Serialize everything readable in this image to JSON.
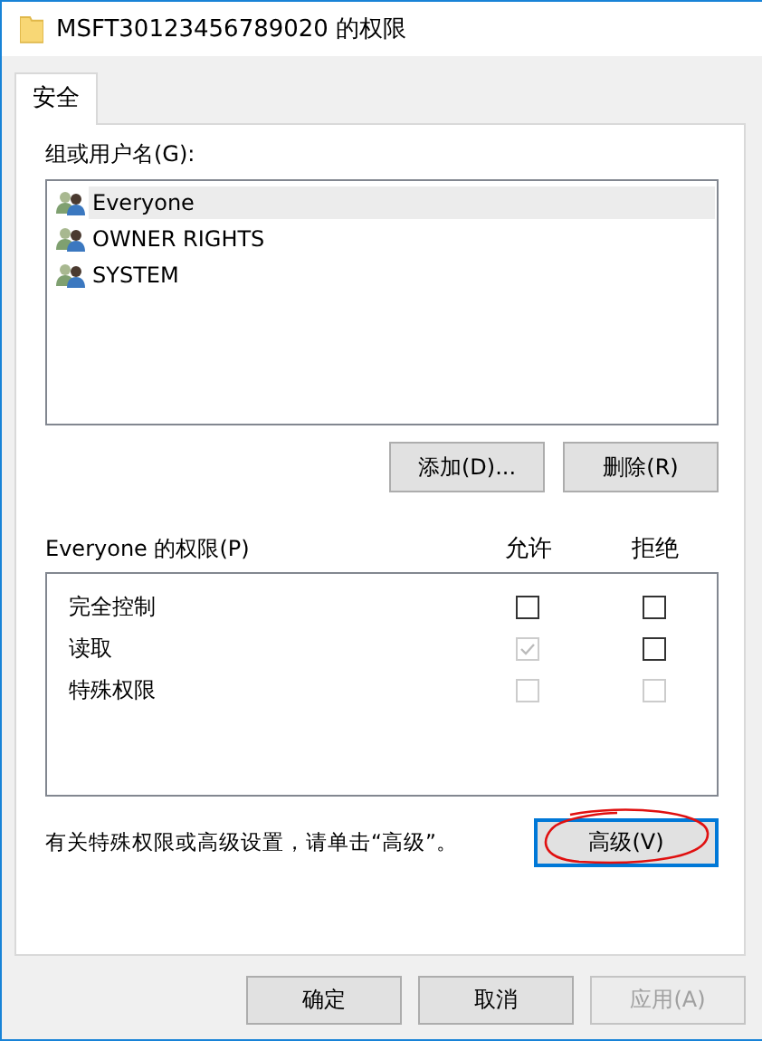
{
  "window": {
    "title": "MSFT30123456789020 的权限"
  },
  "tabs": [
    {
      "label": "安全",
      "selected": true
    }
  ],
  "groups": {
    "label": "组或用户名(G):",
    "items": [
      {
        "name": "Everyone",
        "selected": true
      },
      {
        "name": "OWNER RIGHTS",
        "selected": false
      },
      {
        "name": "SYSTEM",
        "selected": false
      }
    ]
  },
  "group_buttons": [
    {
      "label": "添加(D)..."
    },
    {
      "label": "删除(R)"
    }
  ],
  "permissions": {
    "label": "Everyone 的权限(P)",
    "allow_header": "允许",
    "deny_header": "拒绝",
    "rows": [
      {
        "name": "完全控制",
        "allow": {
          "checked": false,
          "disabled": false
        },
        "deny": {
          "checked": false,
          "disabled": false
        }
      },
      {
        "name": "读取",
        "allow": {
          "checked": true,
          "disabled": true
        },
        "deny": {
          "checked": false,
          "disabled": false
        }
      },
      {
        "name": "特殊权限",
        "allow": {
          "checked": false,
          "disabled": true
        },
        "deny": {
          "checked": false,
          "disabled": true
        }
      }
    ]
  },
  "advanced_note": "有关特殊权限或高级设置，请单击“高级”。",
  "advanced_button": {
    "label": "高级(V)",
    "focused": true
  },
  "buttons": [
    {
      "label": "确定",
      "disabled": false
    },
    {
      "label": "取消",
      "disabled": false
    },
    {
      "label": "应用(A)",
      "disabled": true
    }
  ]
}
